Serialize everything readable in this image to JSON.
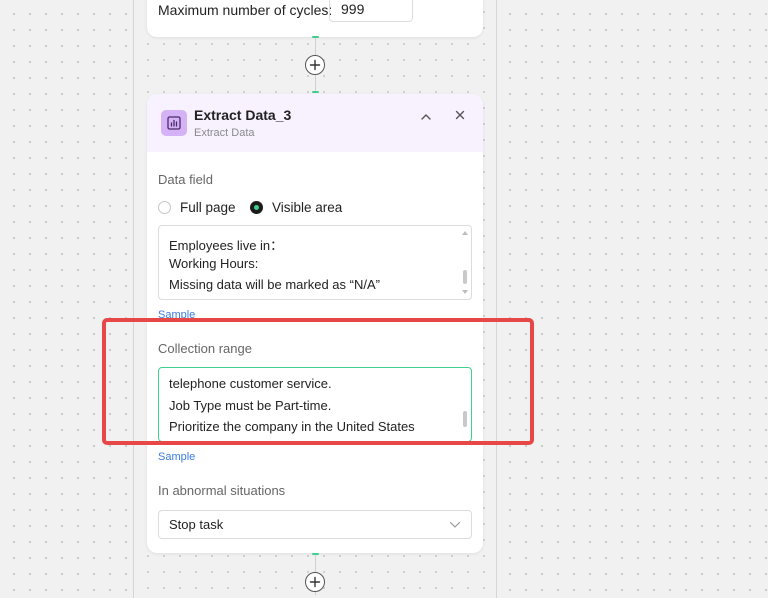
{
  "loop_card": {
    "max_cycles_label": "Maximum number of cycles:",
    "max_cycles_value": "999"
  },
  "step": {
    "title": "Extract Data_3",
    "subtitle": "Extract Data",
    "icon": "chart-icon",
    "accent_color": "#d5b2f5",
    "header_bg": "#f8f1ff"
  },
  "data_field": {
    "label": "Data field",
    "options": [
      "Full page",
      "Visible area"
    ],
    "selected": "Visible area",
    "lines": [
      "Employees live in：",
      "Working Hours:",
      "Missing data will be marked as “N/A”"
    ],
    "sample_link": "Sample"
  },
  "collection_range": {
    "label": "Collection range",
    "lines": [
      "telephone customer service.",
      "Job Type must be Part-time.",
      "Prioritize the company in the United States"
    ],
    "sample_link": "Sample"
  },
  "abnormal": {
    "label": "In abnormal situations",
    "selected": "Stop task"
  },
  "colors": {
    "accent_green": "#3fcf8e",
    "link_blue": "#3b7be0",
    "highlight_red": "#e84747"
  }
}
